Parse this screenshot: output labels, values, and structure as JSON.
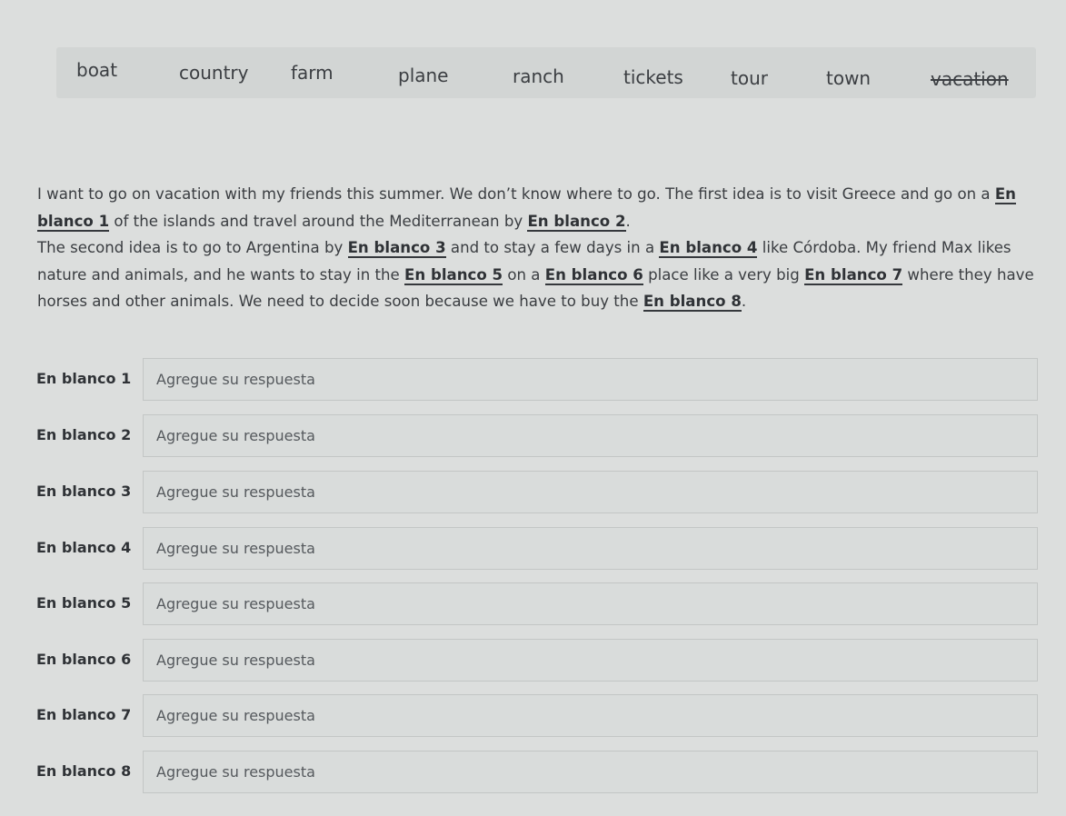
{
  "word_bank": {
    "words": [
      {
        "text": "boat",
        "struck": false
      },
      {
        "text": "country",
        "struck": false
      },
      {
        "text": "farm",
        "struck": false
      },
      {
        "text": "plane",
        "struck": false
      },
      {
        "text": "ranch",
        "struck": false
      },
      {
        "text": "tickets",
        "struck": false
      },
      {
        "text": "tour",
        "struck": false
      },
      {
        "text": "town",
        "struck": false
      },
      {
        "text": "vacation",
        "struck": true
      }
    ]
  },
  "passage": {
    "l1": "I want to go on vacation with my friends this summer. We don’t know where to go. The first idea is to visit Greece and go on a ",
    "b1a": "En",
    "b1b": "blanco 1",
    "l2": " of the islands and travel around the Mediterranean by ",
    "b2": "En blanco 2",
    "l2_end": ".",
    "l3": "The second idea is to go to Argentina by ",
    "b3": "En blanco 3",
    "l3_mid": " and to stay a few days in a ",
    "b4": "En blanco 4",
    "l3_end": " like Córdoba. My friend Max likes nature and animals, and he wants to stay in the ",
    "b5": "En blanco 5",
    "l4_mid": " on a ",
    "b6": "En blanco 6",
    "l4_mid2": " place like a very big ",
    "b7": "En blanco 7",
    "l4_end": " where they have horses and other animals. We need to decide soon because we have to buy the ",
    "b8": "En blanco 8",
    "l5_end": "."
  },
  "answers": {
    "placeholder": "Agregue su respuesta",
    "rows": [
      {
        "label": "En blanco 1",
        "value": ""
      },
      {
        "label": "En blanco 2",
        "value": ""
      },
      {
        "label": "En blanco 3",
        "value": ""
      },
      {
        "label": "En blanco 4",
        "value": ""
      },
      {
        "label": "En blanco 5",
        "value": ""
      },
      {
        "label": "En blanco 6",
        "value": ""
      },
      {
        "label": "En blanco 7",
        "value": ""
      },
      {
        "label": "En blanco 8",
        "value": ""
      }
    ]
  }
}
